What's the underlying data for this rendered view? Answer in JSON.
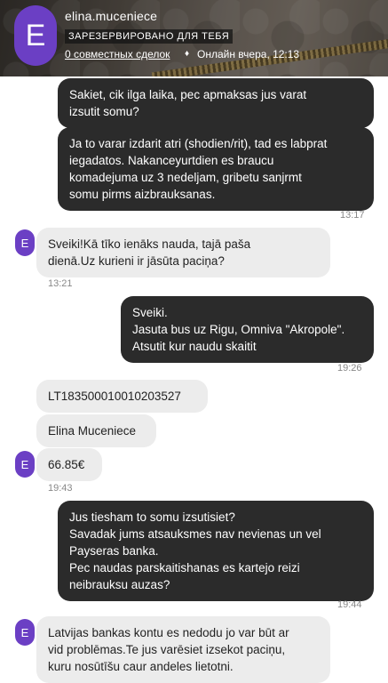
{
  "header": {
    "avatar_letter": "E",
    "name": "elina.muceniece",
    "badge": "ЗАРЕЗЕРВИРОВАНО ДЛЯ ТЕБЯ",
    "deals": "0 совместных сделок",
    "separator": "♦",
    "online": "Онлайн вчера, 12:13"
  },
  "messages": {
    "m1": [
      "Sakiet, cik ilga laika, pec apmaksas jus varat",
      "izsutit somu?"
    ],
    "m2": [
      "Ja to varar izdarit atri (shodien/rit), tad es labprat",
      "iegadatos. Nakanceyurtdien es braucu",
      "komadejuma uz 3 nedeljam, gribetu sanjrmt",
      "somu pirms aizbrauksanas."
    ],
    "t1": "13:17",
    "m3": [
      "Sveiki!Kā tīko ienāks nauda, tajā paša",
      "dienā.Uz kurieni ir jāsūta paciņa?"
    ],
    "t2": "13:21",
    "m4": [
      "Sveiki.",
      "Jasuta bus uz Rigu, Omniva \"Akropole\".",
      "Atsutit kur naudu skaitit"
    ],
    "t3": "19:26",
    "m5": "LT183500010010203527",
    "m6": "Elina Muceniece",
    "m7": "66.85€",
    "t4": "19:43",
    "m8": [
      "Jus tiesham to somu izsutisiet?",
      "Savadak jums atsauksmes nav nevienas un vel",
      "Payseras banka.",
      "Pec naudas parskaitishanas es kartejo reizi",
      "neibrauksu auzas?"
    ],
    "t5": "19:44",
    "m9": [
      "Latvijas bankas kontu es nedodu jo var būt ar",
      "vid problēmas.Te jus varēsiet izsekot paciņu,",
      "kuru nosūtīšu caur andeles lietotni."
    ],
    "avatar_letter": "E"
  }
}
